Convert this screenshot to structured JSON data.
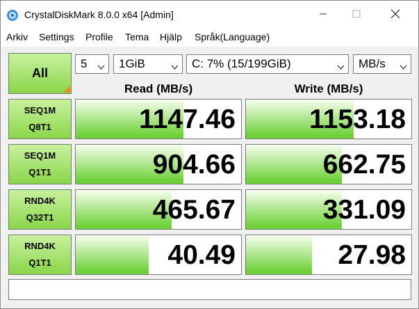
{
  "window": {
    "title": "CrystalDiskMark 8.0.0 x64 [Admin]"
  },
  "menu": [
    "Arkiv",
    "Settings",
    "Profile",
    "Tema",
    "Hjälp",
    "Språk(Language)"
  ],
  "controls": {
    "all_label": "All",
    "count": "5",
    "size": "1GiB",
    "drive": "C: 7% (15/199GiB)",
    "unit": "MB/s"
  },
  "headers": {
    "read": "Read (MB/s)",
    "write": "Write (MB/s)"
  },
  "tests": [
    {
      "line1": "SEQ1M",
      "line2": "Q8T1",
      "read": "1147.46",
      "write": "1153.18",
      "read_fill": 0.65,
      "write_fill": 0.65
    },
    {
      "line1": "SEQ1M",
      "line2": "Q1T1",
      "read": "904.66",
      "write": "662.75",
      "read_fill": 0.65,
      "write_fill": 0.58
    },
    {
      "line1": "RND4K",
      "line2": "Q32T1",
      "read": "465.67",
      "write": "331.09",
      "read_fill": 0.58,
      "write_fill": 0.58
    },
    {
      "line1": "RND4K",
      "line2": "Q1T1",
      "read": "40.49",
      "write": "27.98",
      "read_fill": 0.44,
      "write_fill": 0.4
    }
  ],
  "comment": "",
  "colors": {
    "accent_green": "#6fd13a",
    "button_green": "#8ad54a",
    "corner_orange": "#f08a1e"
  },
  "icons": [
    "app-icon",
    "minimize-icon",
    "maximize-icon",
    "close-icon",
    "dropdown-arrow-icon"
  ]
}
